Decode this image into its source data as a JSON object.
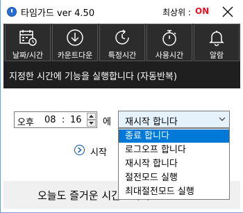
{
  "window": {
    "title": "타임가드 ver 4.50",
    "top_label": "최상위 :",
    "top_status": "ON",
    "accent_color": "#2a6fd6",
    "status_color": "#e81123"
  },
  "toolbar": {
    "items": [
      {
        "label": "날짜/시간",
        "icon": "calendar-clock-icon"
      },
      {
        "label": "카운트다운",
        "icon": "download-circle-icon"
      },
      {
        "label": "특정시간",
        "icon": "clock-refresh-icon"
      },
      {
        "label": "사용시간",
        "icon": "stopwatch-icon"
      },
      {
        "label": "알람",
        "icon": "bell-icon"
      }
    ]
  },
  "info": {
    "text": "지정한 시간에 기능을 실행합니다 (자동반복)"
  },
  "time_picker": {
    "ampm": "오후",
    "hour": "08",
    "colon": ":",
    "minute": "16"
  },
  "conjunction": "에",
  "action_select": {
    "value": "재시작 합니다",
    "options": [
      "종료 합니다",
      "로그오프 합니다",
      "재시작 합니다",
      "절전모드 실행",
      "최대절전모드 실행"
    ],
    "highlighted_index": 0
  },
  "start": {
    "label": "시작"
  },
  "footer": {
    "text": "오늘도 즐거운 시간보내세요~"
  }
}
